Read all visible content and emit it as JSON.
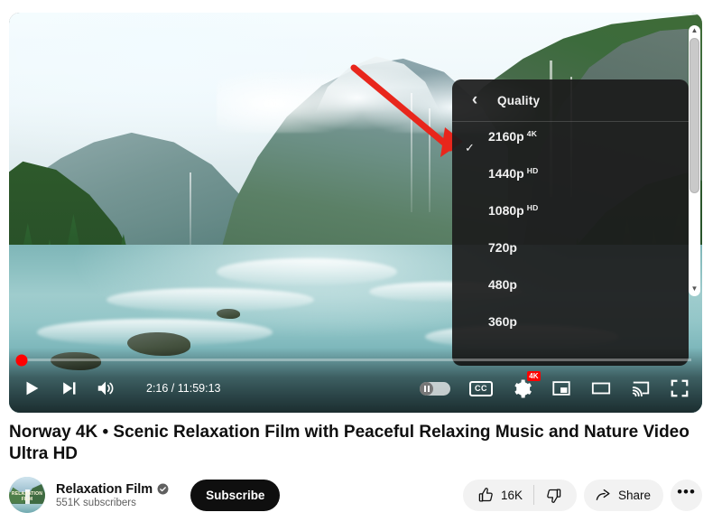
{
  "player": {
    "time_display": "2:16 / 11:59:13",
    "current_time": "2:16",
    "duration": "11:59:13",
    "progress_percent": 0.32,
    "controls": {
      "play_label": "play-pause",
      "next_label": "next-video",
      "volume_label": "volume",
      "autoplay_label": "autoplay",
      "captions_label": "CC",
      "settings_label": "settings",
      "settings_badge": "4K",
      "miniplayer_label": "miniplayer",
      "theater_label": "theater-mode",
      "cast_label": "cast",
      "fullscreen_label": "fullscreen"
    }
  },
  "quality_menu": {
    "back_chevron": "‹",
    "title": "Quality",
    "scroll_up_arrow": "▲",
    "scroll_down_arrow": "▼",
    "options": [
      {
        "label": "2160p",
        "sup": "4K",
        "selected": true,
        "check": "✓"
      },
      {
        "label": "1440p",
        "sup": "HD",
        "selected": false,
        "check": ""
      },
      {
        "label": "1080p",
        "sup": "HD",
        "selected": false,
        "check": ""
      },
      {
        "label": "720p",
        "sup": "",
        "selected": false,
        "check": ""
      },
      {
        "label": "480p",
        "sup": "",
        "selected": false,
        "check": ""
      },
      {
        "label": "360p",
        "sup": "",
        "selected": false,
        "check": ""
      }
    ]
  },
  "video": {
    "title": "Norway 4K • Scenic Relaxation Film with Peaceful Relaxing Music and Nature Video Ultra HD"
  },
  "channel": {
    "name": "Relaxation Film",
    "avatar_text": "RELAXATION FILM",
    "verified": true,
    "subscribers": "551K subscribers",
    "subscribe_label": "Subscribe"
  },
  "actions": {
    "like_count": "16K",
    "share_label": "Share",
    "more_label": "•••"
  },
  "colors": {
    "brand_red": "#ff0000",
    "annotation_red": "#e8261c",
    "subscribe_bg": "#0f0f0f",
    "pill_bg": "#f2f2f2",
    "menu_bg": "#1c1c1c"
  }
}
